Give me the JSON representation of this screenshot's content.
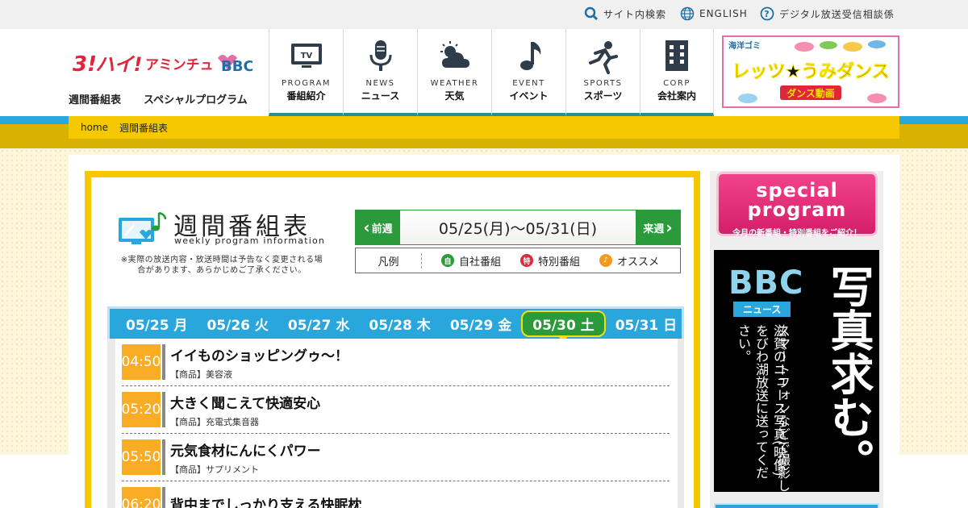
{
  "utility": {
    "search": "サイト内検索",
    "english": "ENGLISH",
    "digital": "デジタル放送受信相談係"
  },
  "header": {
    "logo_text": "3!ハイ!アミンチュBBC",
    "sub_links": [
      "週間番組表",
      "スペシャルプログラム"
    ],
    "nav": [
      {
        "en": "PROGRAM",
        "ja": "番組紹介",
        "icon": "tv-icon"
      },
      {
        "en": "NEWS",
        "ja": "ニュース",
        "icon": "microphone-icon"
      },
      {
        "en": "WEATHER",
        "ja": "天気",
        "icon": "weather-icon"
      },
      {
        "en": "EVENT",
        "ja": "イベント",
        "icon": "music-note-icon"
      },
      {
        "en": "SPORTS",
        "ja": "スポーツ",
        "icon": "sports-icon"
      },
      {
        "en": "CORP",
        "ja": "会社案内",
        "icon": "building-icon"
      }
    ],
    "dance_banner": {
      "top": "海洋ゴミ",
      "main": "レッツ★うみダンス",
      "sub": "ダンス動画"
    }
  },
  "breadcrumb": [
    "home",
    "週間番組表"
  ],
  "schedule": {
    "title": "週間番組表",
    "subtitle": "weekly program information",
    "note": "※実際の放送内容・放送時間は予告なく変更される場合があります、あらかじめご了承ください。",
    "prev": "前週",
    "next": "来週",
    "range": "05/25(月)～05/31(日)",
    "legend_label": "凡例",
    "legend": [
      {
        "mark": "自",
        "label": "自社番組",
        "color": "#2a9a3a"
      },
      {
        "mark": "特",
        "label": "特別番組",
        "color": "#e0263a"
      },
      {
        "mark": "♪",
        "label": "オススメ",
        "color": "#f39a1e"
      }
    ],
    "days": [
      "05/25 月",
      "05/26 火",
      "05/27 水",
      "05/28 木",
      "05/29 金",
      "05/30 土",
      "05/31 日"
    ],
    "active_day": "05/30 土",
    "programs": [
      {
        "time": "04:50",
        "title": "イイものショッピングゥ～！",
        "sub": "【商品】美容液"
      },
      {
        "time": "05:20",
        "title": "大きく聞こえて快適安心",
        "sub": "【商品】充電式集音器"
      },
      {
        "time": "05:50",
        "title": "元気食材にんにくパワー",
        "sub": "【商品】サプリメント"
      },
      {
        "time": "06:20",
        "title": "背中までしっかり支える快眠枕",
        "sub": ""
      }
    ]
  },
  "sidebar": {
    "special": {
      "title": "special program",
      "sub": "今月の新番組・特別番組をご紹介！"
    },
    "bbc": {
      "logo": "BBC",
      "tag": "ニュース",
      "headline": "写真求む。",
      "copy1": "スマートフォンなどで撮影した、",
      "copy2": "滋賀のニュース写真(映像)をびわ湖放送に送ってください。"
    }
  },
  "colors": {
    "accent_blue": "#29a7dd",
    "accent_yellow": "#f5c800",
    "accent_green": "#2a9a3a",
    "time_orange": "#f9ad25"
  }
}
